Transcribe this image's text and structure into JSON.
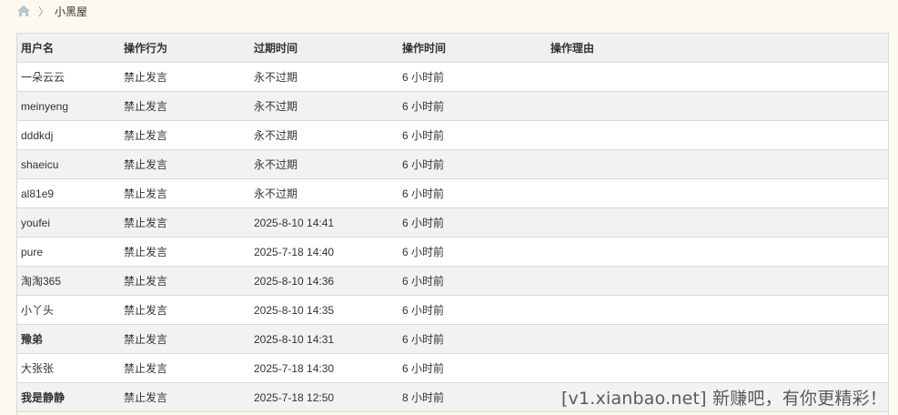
{
  "breadcrumb": {
    "home_icon": "home-icon",
    "separator": "〉",
    "current": "小黑屋"
  },
  "table": {
    "headers": [
      "用户名",
      "操作行为",
      "过期时间",
      "操作时间",
      "操作理由"
    ],
    "rows": [
      {
        "user": "一朵云云",
        "action": "禁止发言",
        "expire": "永不过期",
        "time": "6 小时前",
        "reason": ""
      },
      {
        "user": "meinyeng",
        "action": "禁止发言",
        "expire": "永不过期",
        "time": "6 小时前",
        "reason": ""
      },
      {
        "user": "dddkdj",
        "action": "禁止发言",
        "expire": "永不过期",
        "time": "6 小时前",
        "reason": ""
      },
      {
        "user": "shaeicu",
        "action": "禁止发言",
        "expire": "永不过期",
        "time": "6 小时前",
        "reason": ""
      },
      {
        "user": "al81e9",
        "action": "禁止发言",
        "expire": "永不过期",
        "time": "6 小时前",
        "reason": ""
      },
      {
        "user": "youfei",
        "action": "禁止发言",
        "expire": "2025-8-10 14:41",
        "time": "6 小时前",
        "reason": ""
      },
      {
        "user": "pure",
        "action": "禁止发言",
        "expire": "2025-7-18 14:40",
        "time": "6 小时前",
        "reason": ""
      },
      {
        "user": "淘淘365",
        "action": "禁止发言",
        "expire": "2025-8-10 14:36",
        "time": "6 小时前",
        "reason": ""
      },
      {
        "user": "小丫头",
        "action": "禁止发言",
        "expire": "2025-8-10 14:35",
        "time": "6 小时前",
        "reason": ""
      },
      {
        "user": "豫弟",
        "action": "禁止发言",
        "expire": "2025-8-10 14:31",
        "time": "6 小时前",
        "reason": ""
      },
      {
        "user": "大张张",
        "action": "禁止发言",
        "expire": "2025-7-18 14:30",
        "time": "6 小时前",
        "reason": ""
      },
      {
        "user": "我是静静",
        "action": "禁止发言",
        "expire": "2025-7-18 12:50",
        "time": "8 小时前",
        "reason": ""
      }
    ]
  },
  "watermark": "[v1.xianbao.net] 新赚吧，有你更精彩！",
  "colors": {
    "page_bg": "#fcf9ef",
    "header_bg": "#f0f0f0",
    "row_alt_bg": "#f2f2f2",
    "border": "#d9d9d9"
  }
}
